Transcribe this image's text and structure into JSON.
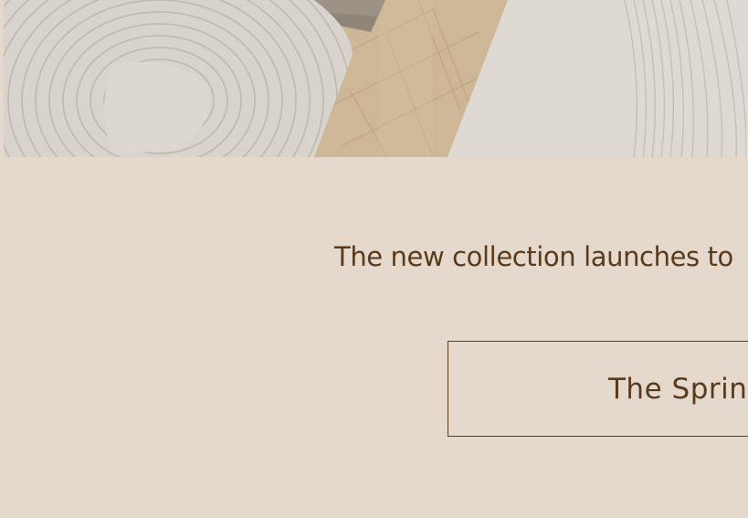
{
  "hero": {
    "image_description_icon": "rugs-photo"
  },
  "promo": {
    "headline": "The new collection launches to",
    "cta_label": "The Spring"
  },
  "colors": {
    "background": "#e4d9cc",
    "text": "#5a3a1a",
    "border": "#5a3a1a"
  }
}
